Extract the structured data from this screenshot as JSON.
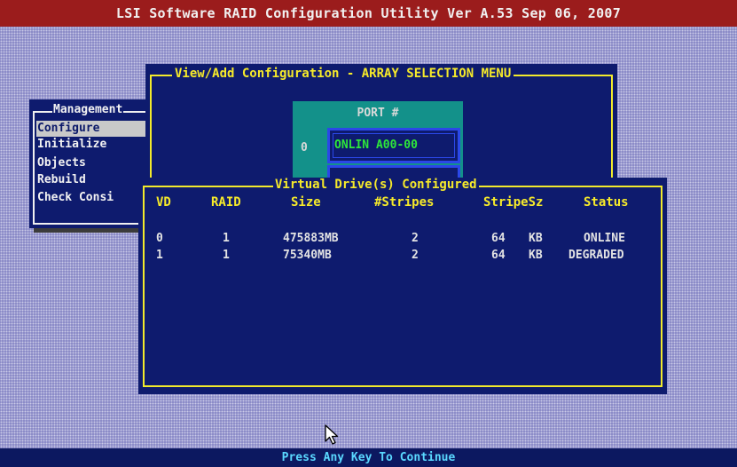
{
  "title_bar": {
    "text": "LSI Software RAID Configuration Utility Ver A.53 Sep 06, 2007"
  },
  "management_menu": {
    "title": "Management",
    "items": [
      {
        "label": "Configure",
        "selected": true
      },
      {
        "label": "Initialize",
        "selected": false
      },
      {
        "label": "Objects",
        "selected": false
      },
      {
        "label": "Rebuild",
        "selected": false
      },
      {
        "label": "Check Consi",
        "selected": false
      }
    ]
  },
  "array_menu": {
    "title": "View/Add Configuration - ARRAY SELECTION MENU",
    "port_header": "PORT #",
    "port_index": "0",
    "port_entry": "ONLIN A00-00"
  },
  "virtual_drives": {
    "title": "Virtual Drive(s) Configured",
    "columns": [
      "VD",
      "RAID",
      "Size",
      "#Stripes",
      "StripeSz",
      "Status"
    ],
    "rows": [
      {
        "vd": "0",
        "raid": "1",
        "size": "475883MB",
        "stripes": "2",
        "stripe_size": "64",
        "stripe_unit": "KB",
        "status": "ONLINE"
      },
      {
        "vd": "1",
        "raid": "1",
        "size": "75340MB",
        "stripes": "2",
        "stripe_size": "64",
        "stripe_unit": "KB",
        "status": "DEGRADED"
      }
    ]
  },
  "status_bar": {
    "text": "Press Any Key To Continue"
  },
  "colors": {
    "title_bg": "#9b1c1c",
    "window_bg": "#0e1b6e",
    "frame_yellow": "#f2ea2c",
    "port_teal": "#13918a",
    "online_green": "#2ee83a",
    "status_text": "#5ad8ff"
  },
  "icons": {
    "cursor": "mouse-pointer-icon"
  }
}
